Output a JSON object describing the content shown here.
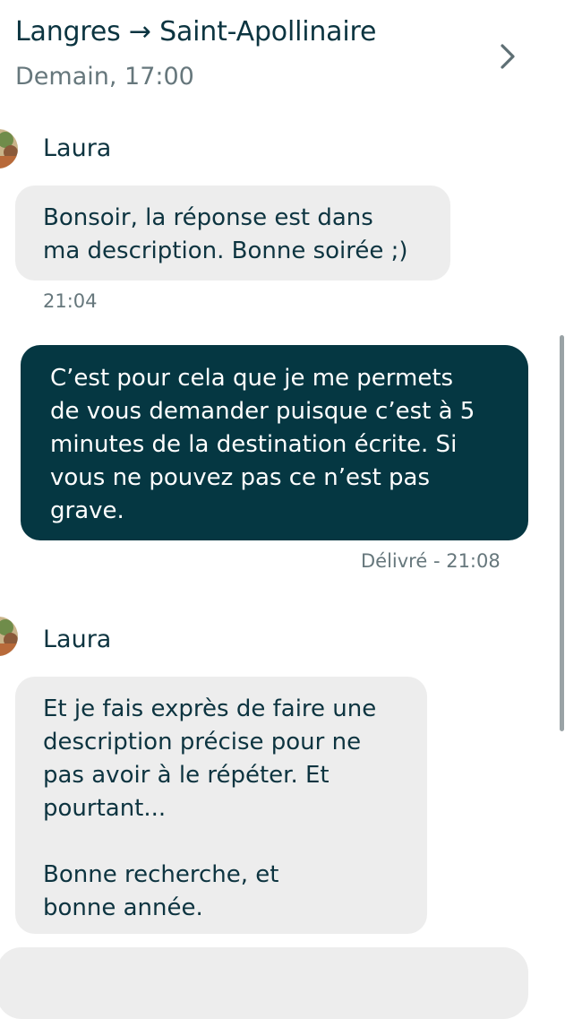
{
  "header": {
    "route": "Langres → Saint-Apollinaire",
    "date": "Demain, 17:00"
  },
  "messages": [
    {
      "sender": "Laura",
      "lines": [
        "Bonsoir, la réponse est dans",
        "ma description. Bonne soirée ;)"
      ],
      "time": "21:04"
    },
    {
      "lines": [
        "C’est pour cela que je me permets",
        "de vous demander puisque c’est à 5",
        "minutes de la destination écrite. Si",
        "vous ne pouvez pas ce n’est pas",
        "grave."
      ],
      "status": "Délivré - 21:08"
    },
    {
      "sender": "Laura",
      "lines": [
        "Et je fais exprès de faire une",
        "description précise pour ne",
        "pas avoir à le répéter. Et",
        "pourtant...",
        "",
        "Bonne recherche, et",
        "bonne année."
      ]
    }
  ],
  "icons": {
    "chevron": "chevron-right-icon",
    "avatar": "avatar"
  },
  "colors": {
    "outgoing_bubble": "#053742",
    "incoming_bubble": "#ededed",
    "text_primary": "#0d3440",
    "text_muted": "#66777c"
  }
}
